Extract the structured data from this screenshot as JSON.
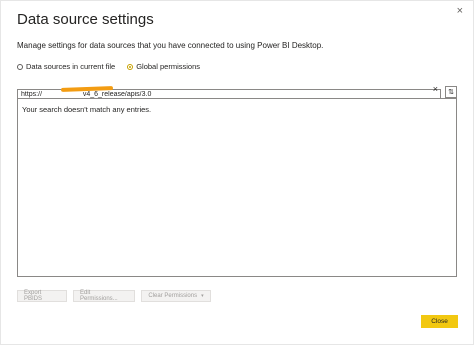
{
  "dialog": {
    "title": "Data source settings",
    "description": "Manage settings for data sources that you have connected to using Power BI Desktop.",
    "close_x": "×"
  },
  "scope": {
    "options": [
      {
        "label": "Data sources in current file",
        "selected": false
      },
      {
        "label": "Global permissions",
        "selected": true
      }
    ]
  },
  "search": {
    "value": "https://                     v4_6_release/apis/3.0",
    "clear_icon": "×",
    "sort_icon": "⇅"
  },
  "results": {
    "empty_message": "Your search doesn't match any entries."
  },
  "actions": {
    "export_label": "Export PBIDS",
    "edit_label": "Edit Permissions...",
    "clear_label": "Clear Permissions",
    "clear_caret": "▾"
  },
  "footer": {
    "close_label": "Close"
  },
  "colors": {
    "accent": "#f2c811",
    "redaction": "#f39c12"
  }
}
